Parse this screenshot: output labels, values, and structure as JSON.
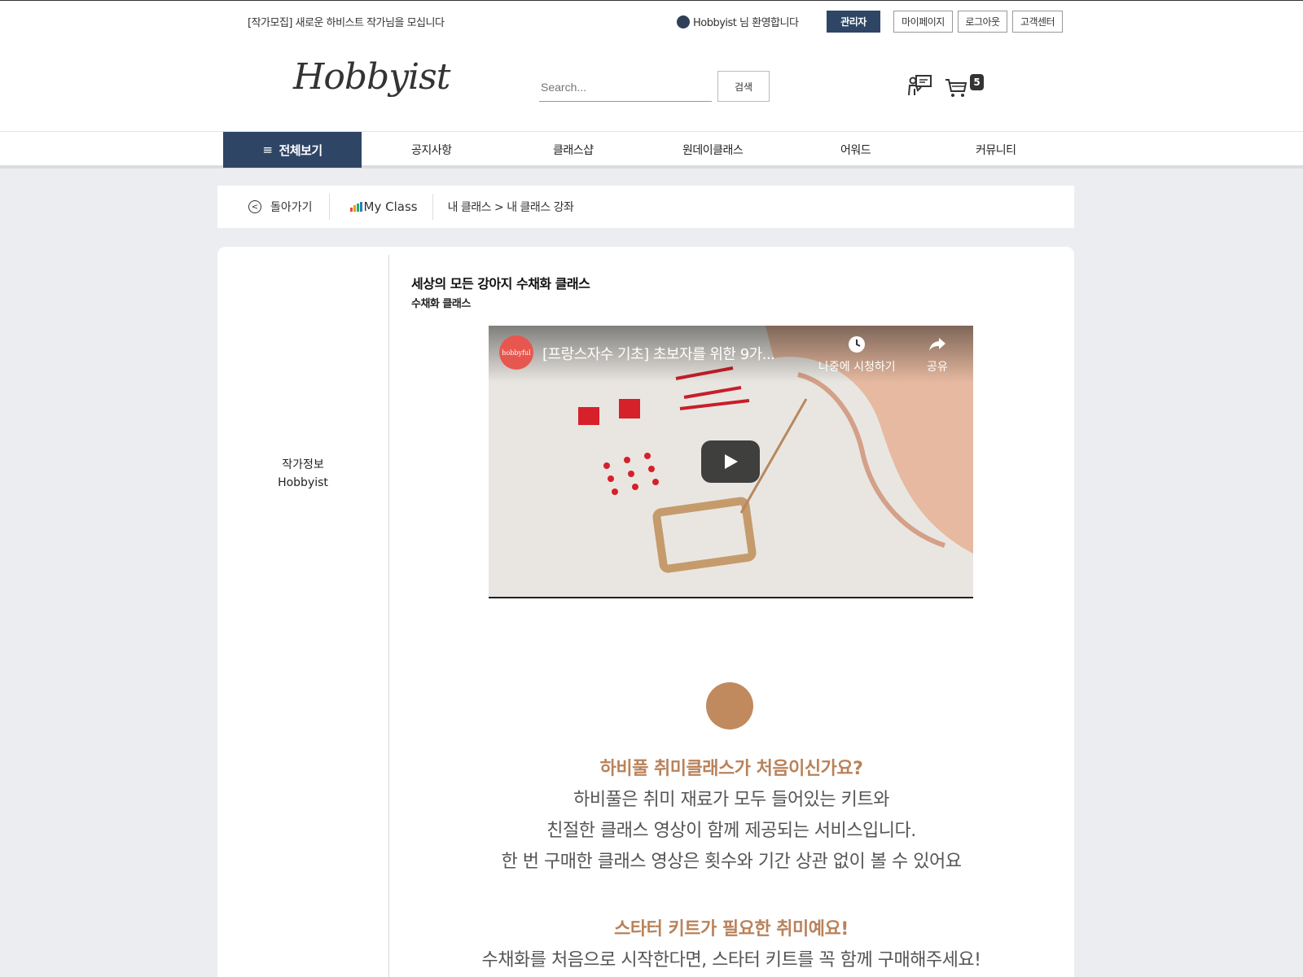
{
  "topbar": {
    "notice": "[작가모집] 새로운 하비스트 작가님을 모십니다",
    "welcome": "Hobbyist 님 환영합니다",
    "admin_label": "관리자",
    "mypage_label": "마이페이지",
    "logout_label": "로그아웃",
    "support_label": "고객센터"
  },
  "header": {
    "logo_text": "Hobbyist",
    "search_placeholder": "Search...",
    "search_button": "검색",
    "cart_count": "5"
  },
  "nav": {
    "all_label": "전체보기",
    "items": [
      "공지사항",
      "클래스샵",
      "원데이클래스",
      "어워드",
      "커뮤니티"
    ]
  },
  "breadcrumb": {
    "back_label": "돌아가기",
    "myclass_label": "My Class",
    "path": "내 클래스 > 내 클래스 강좌"
  },
  "sidebar": {
    "author_heading": "작가정보",
    "author_name": "Hobbyist"
  },
  "course": {
    "title": "세상의 모든 강아지 수채화 클래스",
    "subtitle": "수채화 클래스"
  },
  "video": {
    "channel": "hobbyful",
    "title": "[프랑스자수 기초] 초보자를 위한 9가...",
    "watch_later": "나중에 시청하기",
    "share": "공유"
  },
  "promo": {
    "heading1": "하비풀 취미클래스가 처음이신가요?",
    "line1": "하비풀은 취미 재료가 모두 들어있는 키트와",
    "line2": "친절한 클래스 영상이 함께 제공되는 서비스입니다.",
    "line3": "한 번 구매한 클래스 영상은 횟수와 기간 상관 없이 볼 수 있어요",
    "heading2": "스타터 키트가 필요한 취미예요!",
    "line4": "수채화를 처음으로 시작한다면, 스타터 키트를 꼭 함께 구매해주세요!"
  },
  "colors": {
    "navy": "#2f4566",
    "accent": "#b9825a"
  }
}
